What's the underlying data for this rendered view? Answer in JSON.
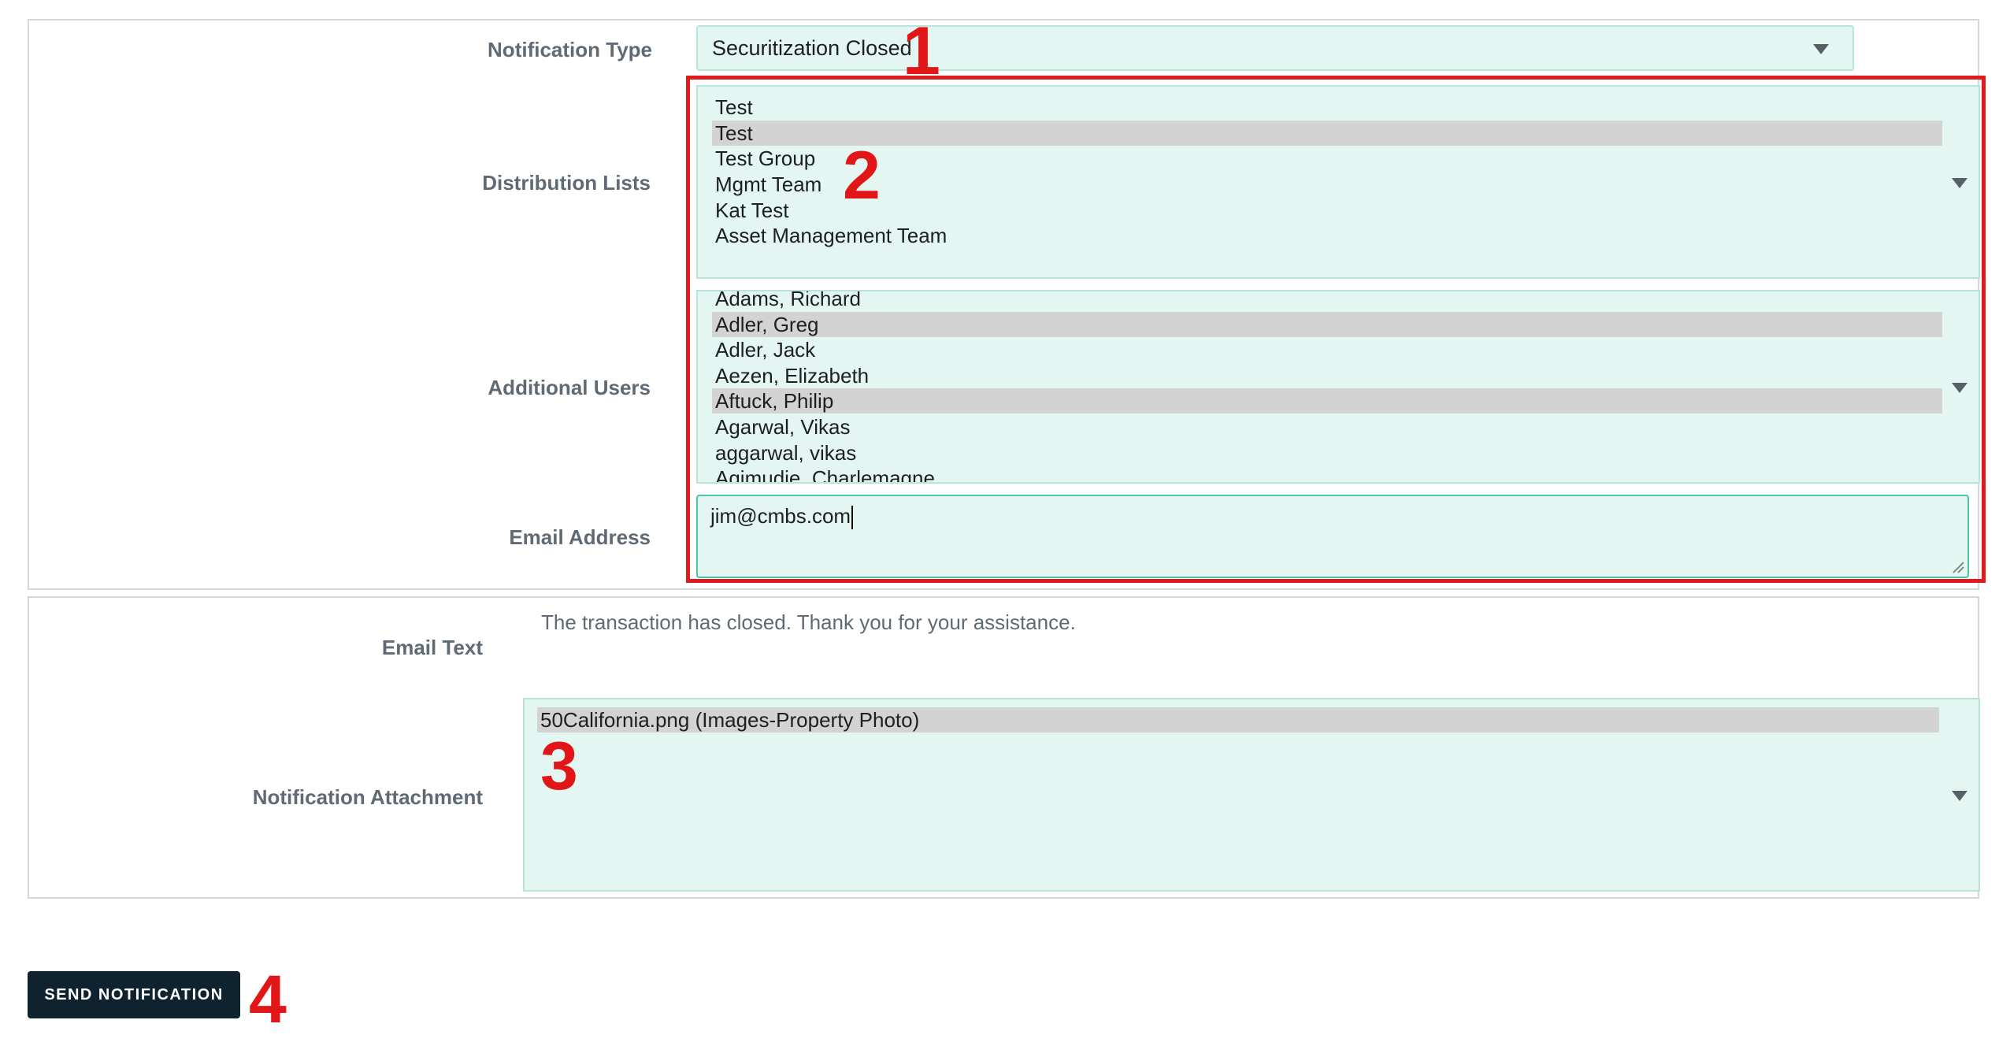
{
  "form": {
    "notification_type": {
      "label": "Notification Type",
      "selected": "Securitization Closed"
    },
    "distribution_lists": {
      "label": "Distribution Lists",
      "options": [
        {
          "label": "Test",
          "selected": false
        },
        {
          "label": "Test",
          "selected": true
        },
        {
          "label": "Test Group",
          "selected": false
        },
        {
          "label": "Mgmt Team",
          "selected": false
        },
        {
          "label": "Kat Test",
          "selected": false
        },
        {
          "label": "Asset Management Team",
          "selected": false
        }
      ]
    },
    "additional_users": {
      "label": "Additional Users",
      "options": [
        {
          "label": "Adams, Richard",
          "selected": false
        },
        {
          "label": "Adler, Greg",
          "selected": true
        },
        {
          "label": "Adler, Jack",
          "selected": false
        },
        {
          "label": "Aezen, Elizabeth",
          "selected": false
        },
        {
          "label": "Aftuck, Philip",
          "selected": true
        },
        {
          "label": "Agarwal, Vikas",
          "selected": false
        },
        {
          "label": "aggarwal, vikas",
          "selected": false
        },
        {
          "label": "Agimudie, Charlemagne",
          "selected": false
        }
      ]
    },
    "email_address": {
      "label": "Email Address",
      "value": "jim@cmbs.com"
    },
    "email_text": {
      "label": "Email Text",
      "value": "The transaction has closed. Thank you for your assistance."
    },
    "notification_attachment": {
      "label": "Notification Attachment",
      "options": [
        {
          "label": "50California.png (Images-Property Photo)",
          "selected": true
        }
      ]
    }
  },
  "send_button": {
    "label": "SEND NOTIFICATION"
  },
  "annotations": [
    "1",
    "2",
    "3",
    "4"
  ],
  "colors": {
    "field_bg": "#e3f6f2",
    "field_border": "#b8e3d8",
    "selected_option": "#d3d3d3",
    "annotation_red": "#e21616",
    "button_bg": "#0f2230",
    "label_text": "#5f6a74"
  }
}
